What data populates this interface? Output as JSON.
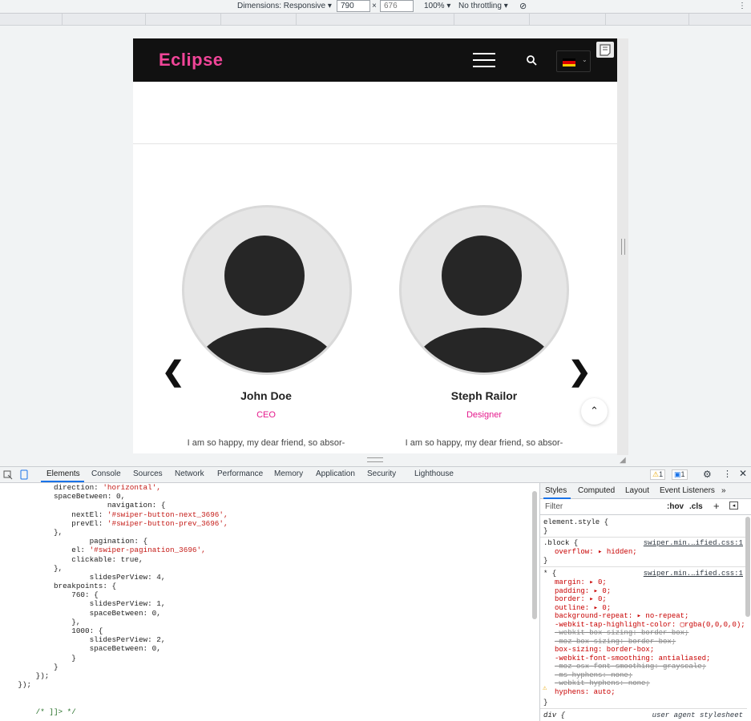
{
  "device_toolbar": {
    "dimensions_label": "Dimensions: Responsive ▾",
    "width": "790",
    "height": "676",
    "times": "×",
    "zoom": "100% ▾",
    "throttling": "No throttling ▾",
    "more": "⋮"
  },
  "site": {
    "logo": "Eclipse",
    "people": [
      {
        "name": "John Doe",
        "role": "CEO",
        "text": "I am so happy, my dear friend, so absor-"
      },
      {
        "name": "Steph Railor",
        "role": "Designer",
        "text": "I am so happy, my dear friend, so absor-"
      }
    ],
    "prev_arrow": "❮",
    "next_arrow": "❯",
    "totop": "⌃"
  },
  "devtools": {
    "tabs": [
      "Elements",
      "Console",
      "Sources",
      "Network",
      "Performance",
      "Memory",
      "Application",
      "Security",
      "Lighthouse"
    ],
    "warnings": "1",
    "messages": "1",
    "code_lines": [
      "            direction: 'horizontal',",
      "            spaceBetween: 0,",
      "                        navigation: {",
      "                nextEl: '#swiper-button-next_3696',",
      "                prevEl: '#swiper-button-prev_3696',",
      "            },",
      "                    pagination: {",
      "                el: '#swiper-pagination_3696',",
      "                clickable: true,",
      "            },",
      "                    slidesPerView: 4,",
      "            breakpoints: {",
      "                760: {",
      "                    slidesPerView: 1,",
      "                    spaceBetween: 0,",
      "                },",
      "                1000: {",
      "                    slidesPerView: 2,",
      "                    spaceBetween: 0,",
      "                }",
      "            }",
      "        });",
      "    });",
      "",
      "",
      "        /* ]]> */"
    ],
    "styles_tabs": [
      "Styles",
      "Computed",
      "Layout",
      "Event Listeners",
      "»"
    ],
    "filter_placeholder": "Filter",
    "hov": ":hov",
    "cls": ".cls",
    "plus": "+",
    "element_style": "element.style {",
    "close_brace": "}",
    "block_selector": ".block {",
    "block_source": "swiper.min.…ified.css:1",
    "block_prop": "overflow: ▸ hidden;",
    "star_selector": "* {",
    "star_source": "swiper.min.…ified.css:1",
    "star_props": [
      {
        "text": "margin: ▸ 0;",
        "strike": false
      },
      {
        "text": "padding: ▸ 0;",
        "strike": false
      },
      {
        "text": "border: ▸ 0;",
        "strike": false
      },
      {
        "text": "outline: ▸ 0;",
        "strike": false
      },
      {
        "text": "background-repeat: ▸ no-repeat;",
        "strike": false
      },
      {
        "text": "-webkit-tap-highlight-color: ▢rgba(0,0,0,0);",
        "strike": false
      },
      {
        "text": "-webkit-box-sizing: border-box;",
        "strike": true
      },
      {
        "text": "-moz-box-sizing: border-box;",
        "strike": true
      },
      {
        "text": "box-sizing: border-box;",
        "strike": false
      },
      {
        "text": "-webkit-font-smoothing: antialiased;",
        "strike": false
      },
      {
        "text": "-moz-osx-font-smoothing: grayscale;",
        "strike": true
      },
      {
        "text": "-ms-hyphens: none;",
        "strike": true
      },
      {
        "text": "-webkit-hyphens: none;",
        "strike": true
      },
      {
        "text": "hyphens: auto;",
        "strike": false
      }
    ],
    "div_selector": "div {",
    "ua_label": "user agent stylesheet"
  },
  "colors": {
    "accent": "#e5198c",
    "logo": "#f04598",
    "nav": "#111111"
  }
}
